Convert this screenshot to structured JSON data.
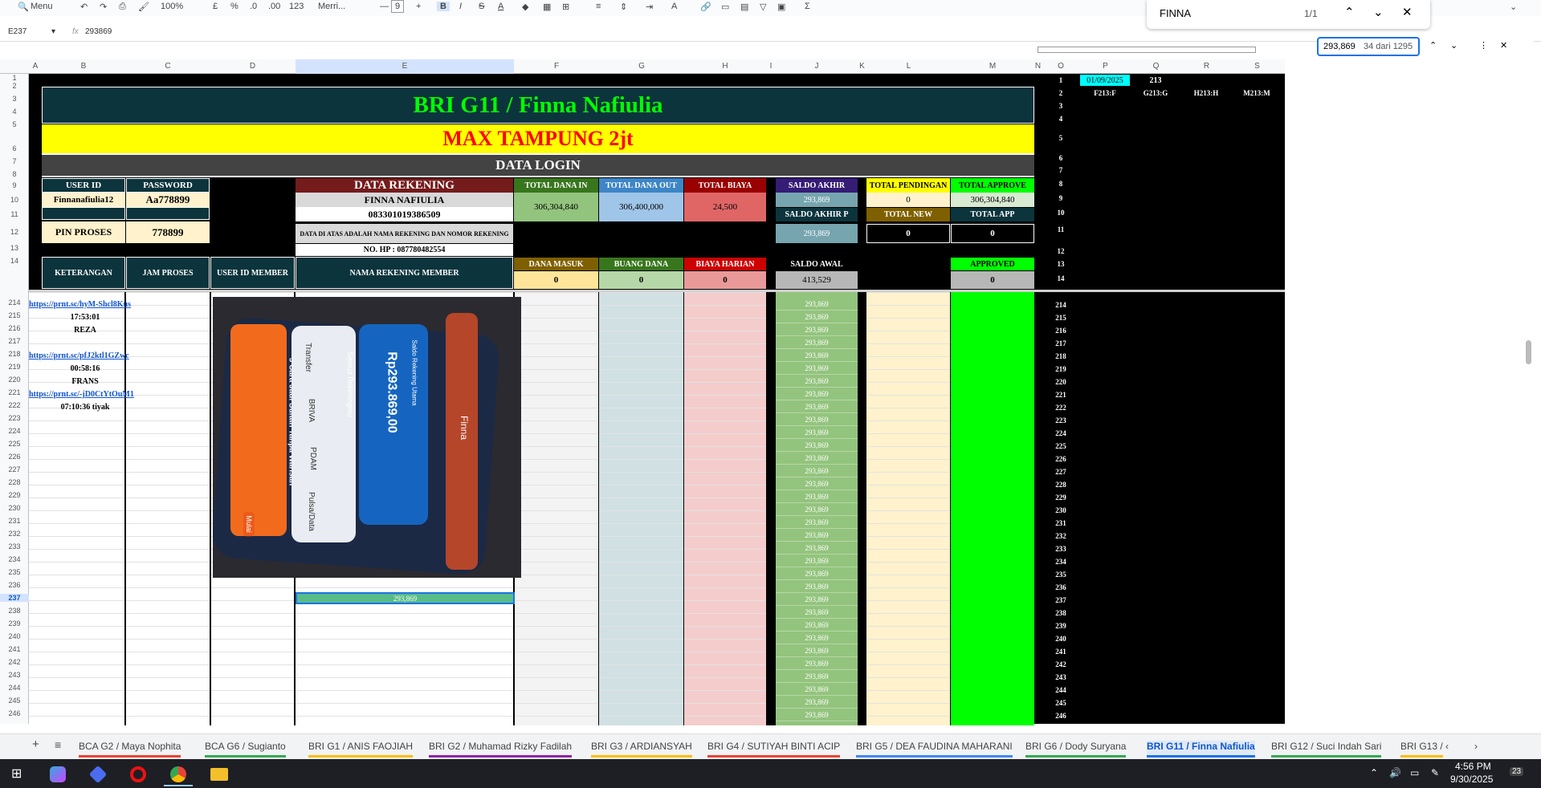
{
  "toolbar": {
    "menu": "Menu",
    "zoom": "100%",
    "currency": "£",
    "percent": "%",
    "dec_less": ".0",
    "dec_more": ".00",
    "num_fmt": "123",
    "font": "Merri...",
    "font_size": "9"
  },
  "formula": {
    "cell_ref": "E237",
    "fx": "fx",
    "value": "293869"
  },
  "find": {
    "query": "FINNA",
    "count": "1/1"
  },
  "find2": {
    "query": "293,869",
    "count": "34 dari 1295"
  },
  "columns": [
    "A",
    "B",
    "C",
    "D",
    "E",
    "F",
    "G",
    "H",
    "I",
    "J",
    "K",
    "L",
    "M",
    "N",
    "O",
    "P",
    "Q",
    "R",
    "S"
  ],
  "header": {
    "title": "BRI G11 / Finna Nafiulia",
    "subtitle": "MAX TAMPUNG 2jt",
    "data_login": "DATA LOGIN",
    "user_id_label": "USER ID",
    "password_label": "PASSWORD",
    "user_id": "Finnanafiulia12",
    "password": "Aa778899",
    "pin_label": "PIN PROSES",
    "pin": "778899",
    "rekening_label": "DATA REKENING",
    "rek_name": "FINNA NAFIULIA",
    "rek_no": "083301019386509",
    "rek_note": "DATA DI ATAS ADALAH NAMA REKENING DAN NOMOR REKENING",
    "hp": "NO. HP : 087780482554",
    "total_dana_in_label": "TOTAL DANA IN",
    "total_dana_in": "306,304,840",
    "total_dana_out_label": "TOTAL DANA OUT",
    "total_dana_out": "306,400,000",
    "total_biaya_label": "TOTAL BIAYA",
    "total_biaya": "24,500",
    "saldo_akhir_label": "SALDO AKHIR",
    "saldo_akhir": "293,869",
    "saldo_akhir_p_label": "SALDO AKHIR P",
    "saldo_akhir_p": "293,869",
    "total_pendingan_label": "TOTAL PENDINGAN",
    "total_pendingan": "0",
    "total_approve_label": "TOTAL APPROVE",
    "total_approve": "306,304,840",
    "total_new_label": "TOTAL NEW",
    "total_new": "0",
    "total_app_label": "TOTAL APP",
    "total_app": "0",
    "ket_label": "KETERANGAN",
    "jam_label": "JAM PROSES",
    "uid_member_label": "USER ID MEMBER",
    "nama_rek_member_label": "NAMA REKENING MEMBER",
    "dana_masuk_label": "DANA MASUK",
    "dana_masuk": "0",
    "buang_dana_label": "BUANG DANA",
    "buang_dana": "0",
    "biaya_harian_label": "BIAYA HARIAN",
    "biaya_harian": "0",
    "saldo_awal_label": "SALDO AWAL",
    "saldo_awal": "413,529",
    "approved_label": "APPROVED",
    "approved": "0"
  },
  "side": {
    "date": "01/09/2025",
    "num": "213",
    "p2": "F213:F",
    "q2": "G213:G",
    "r2": "H213:H",
    "s2": "M213:M"
  },
  "top_rows": [
    "1",
    "2",
    "3",
    "4",
    "5",
    "6",
    "7",
    "8",
    "9",
    "10",
    "11",
    "12",
    "13",
    "14"
  ],
  "rows": [
    {
      "n": "214",
      "b": "https://prnt.sc/hyM-Shcl8Kus",
      "link": true
    },
    {
      "n": "215",
      "b": "17:53:01"
    },
    {
      "n": "216",
      "b": "REZA"
    },
    {
      "n": "217",
      "b": ""
    },
    {
      "n": "218",
      "b": "https://prnt.sc/pfJ2ktl1GZwc",
      "link": true
    },
    {
      "n": "219",
      "b": "00:58:16"
    },
    {
      "n": "220",
      "b": "FRANS"
    },
    {
      "n": "221",
      "b": "https://prnt.sc/-jD0CtYtOuM1",
      "link": true
    },
    {
      "n": "222",
      "b": "07:10:36 tiyak"
    },
    {
      "n": "223",
      "b": ""
    },
    {
      "n": "224",
      "b": ""
    },
    {
      "n": "225",
      "b": ""
    },
    {
      "n": "226",
      "b": ""
    },
    {
      "n": "227",
      "b": ""
    },
    {
      "n": "228",
      "b": ""
    },
    {
      "n": "229",
      "b": ""
    },
    {
      "n": "230",
      "b": ""
    },
    {
      "n": "231",
      "b": ""
    },
    {
      "n": "232",
      "b": ""
    },
    {
      "n": "233",
      "b": ""
    },
    {
      "n": "234",
      "b": ""
    },
    {
      "n": "235",
      "b": ""
    },
    {
      "n": "236",
      "b": ""
    },
    {
      "n": "237",
      "b": ""
    },
    {
      "n": "238",
      "b": ""
    },
    {
      "n": "239",
      "b": ""
    },
    {
      "n": "240",
      "b": ""
    },
    {
      "n": "241",
      "b": ""
    },
    {
      "n": "242",
      "b": ""
    },
    {
      "n": "243",
      "b": ""
    },
    {
      "n": "244",
      "b": ""
    },
    {
      "n": "245",
      "b": ""
    },
    {
      "n": "246",
      "b": ""
    }
  ],
  "j_value": "293,869",
  "e237_value": "293,869",
  "phone_image": {
    "balance": "Rp293.869,00",
    "label1": "Saldo Rekening Utama",
    "label2": "Semua Rekeningmu",
    "menu1": "Transfer",
    "menu2": "BRIVA",
    "menu3": "PDAM",
    "menu4": "Pulsa/Data",
    "promo": "5 Cara Jadi Sultan Tanpa Warisan",
    "name": "Finna",
    "mulai": "Mulai"
  },
  "tabs": [
    "BCA G2 / Maya Nophita",
    "BCA G6 / Sugianto",
    "BRI G1 / ANIS FAOJIAH",
    "BRI G2 / Muhamad Rizky Fadilah",
    "BRI G3 / ARDIANSYAH",
    "BRI G4 / SUTIYAH BINTI ACIP",
    "BRI G5 / DEA FAUDINA MAHARANI",
    "BRI G6 / Dody Suryana",
    "BRI G11 / Finna Nafiulia",
    "BRI G12 / Suci Indah Sari",
    "BRI G13 /"
  ],
  "active_tab": "BRI G11 / Finna Nafiulia",
  "taskbar": {
    "time": "4:56 PM",
    "date": "9/30/2025",
    "badge": "23"
  },
  "colors": {
    "dark_teal": "#0c343d",
    "yellow": "#ffff00",
    "title_green": "#00ff00",
    "red_text": "#ff0000",
    "maroon": "#741b1b",
    "green": "#93c47d",
    "blue": "#9fc5e8",
    "red": "#e06666",
    "purple": "#351c75",
    "gray_teal": "#76a5af",
    "approve_green": "#00ff00"
  }
}
